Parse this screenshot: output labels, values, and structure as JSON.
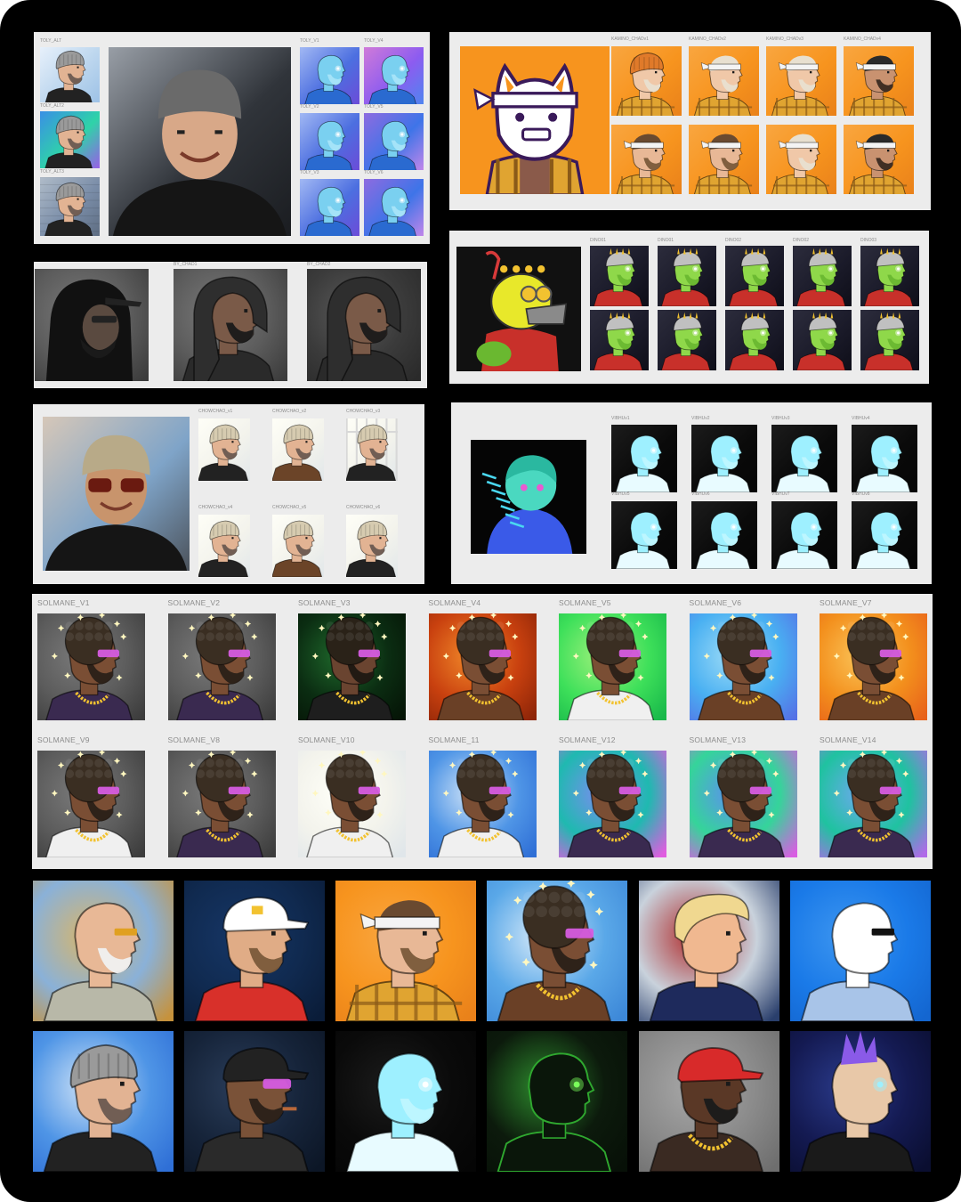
{
  "colors": {
    "frame": "#000000",
    "board": "#ececec",
    "caption": "#8c8c8c",
    "kamino_orange": "#f7941e",
    "plaid": "#e0a431"
  },
  "toly": {
    "captions": [
      "TOLY_ALT",
      "TOLY_ALT2",
      "TOLY_ALT3",
      "TOLY_V1",
      "TOLY_V4",
      "TOLY_V2",
      "TOLY_V5",
      "TOLY_V3",
      "TOLY_V6"
    ]
  },
  "kamino": {
    "captions": [
      "KAMINO_CHADv1",
      "KAMINO_CHADv2",
      "KAMINO_CHADv3",
      "KAMINO_CHADv4"
    ]
  },
  "hood": {
    "captions": [
      "BY_CHAD1",
      "BY_CHAD2"
    ]
  },
  "dino": {
    "captions": [
      "DINO01",
      "DINO01",
      "DINO02",
      "DINO02",
      "DINO03"
    ]
  },
  "chowchao": {
    "captions": [
      "CHOWCHAO_v1",
      "CHOWCHAO_v2",
      "CHOWCHAO_v3",
      "CHOWCHAO_v4",
      "CHOWCHAO_v5",
      "CHOWCHAO_v6"
    ]
  },
  "vibhu": {
    "captions": [
      "VIBHUv1",
      "VIBHUv2",
      "VIBHUv3",
      "VIBHUv4",
      "VIBHUv5",
      "VIBHUv6",
      "VIBHUv7",
      "VIBHUv8"
    ]
  },
  "solmane": {
    "row1": [
      "SOLMANE_V1",
      "SOLMANE_V2",
      "SOLMANE_V3",
      "SOLMANE_V4",
      "SOLMANE_V5",
      "SOLMANE_V6",
      "SOLMANE_V7"
    ],
    "row2": [
      "SOLMANE_V9",
      "SOLMANE_V8",
      "SOLMANE_V10",
      "SOLMANE_11",
      "SOLMANE_V12",
      "SOLMANE_V13",
      "SOLMANE_V14"
    ]
  },
  "gallery": {
    "row1": [
      "old-man-glasses-portrait",
      "captain-hat-portrait",
      "headband-plaid-portrait",
      "afro-visor-portrait",
      "blond-suit-portrait",
      "blue-skull-sunglasses-portrait"
    ],
    "row2": [
      "grey-beanie-portrait",
      "black-cap-cigar-portrait",
      "glowing-spirit-portrait",
      "green-matrix-portrait",
      "red-cap-dreads-portrait",
      "purple-mohawk-portrait"
    ]
  }
}
